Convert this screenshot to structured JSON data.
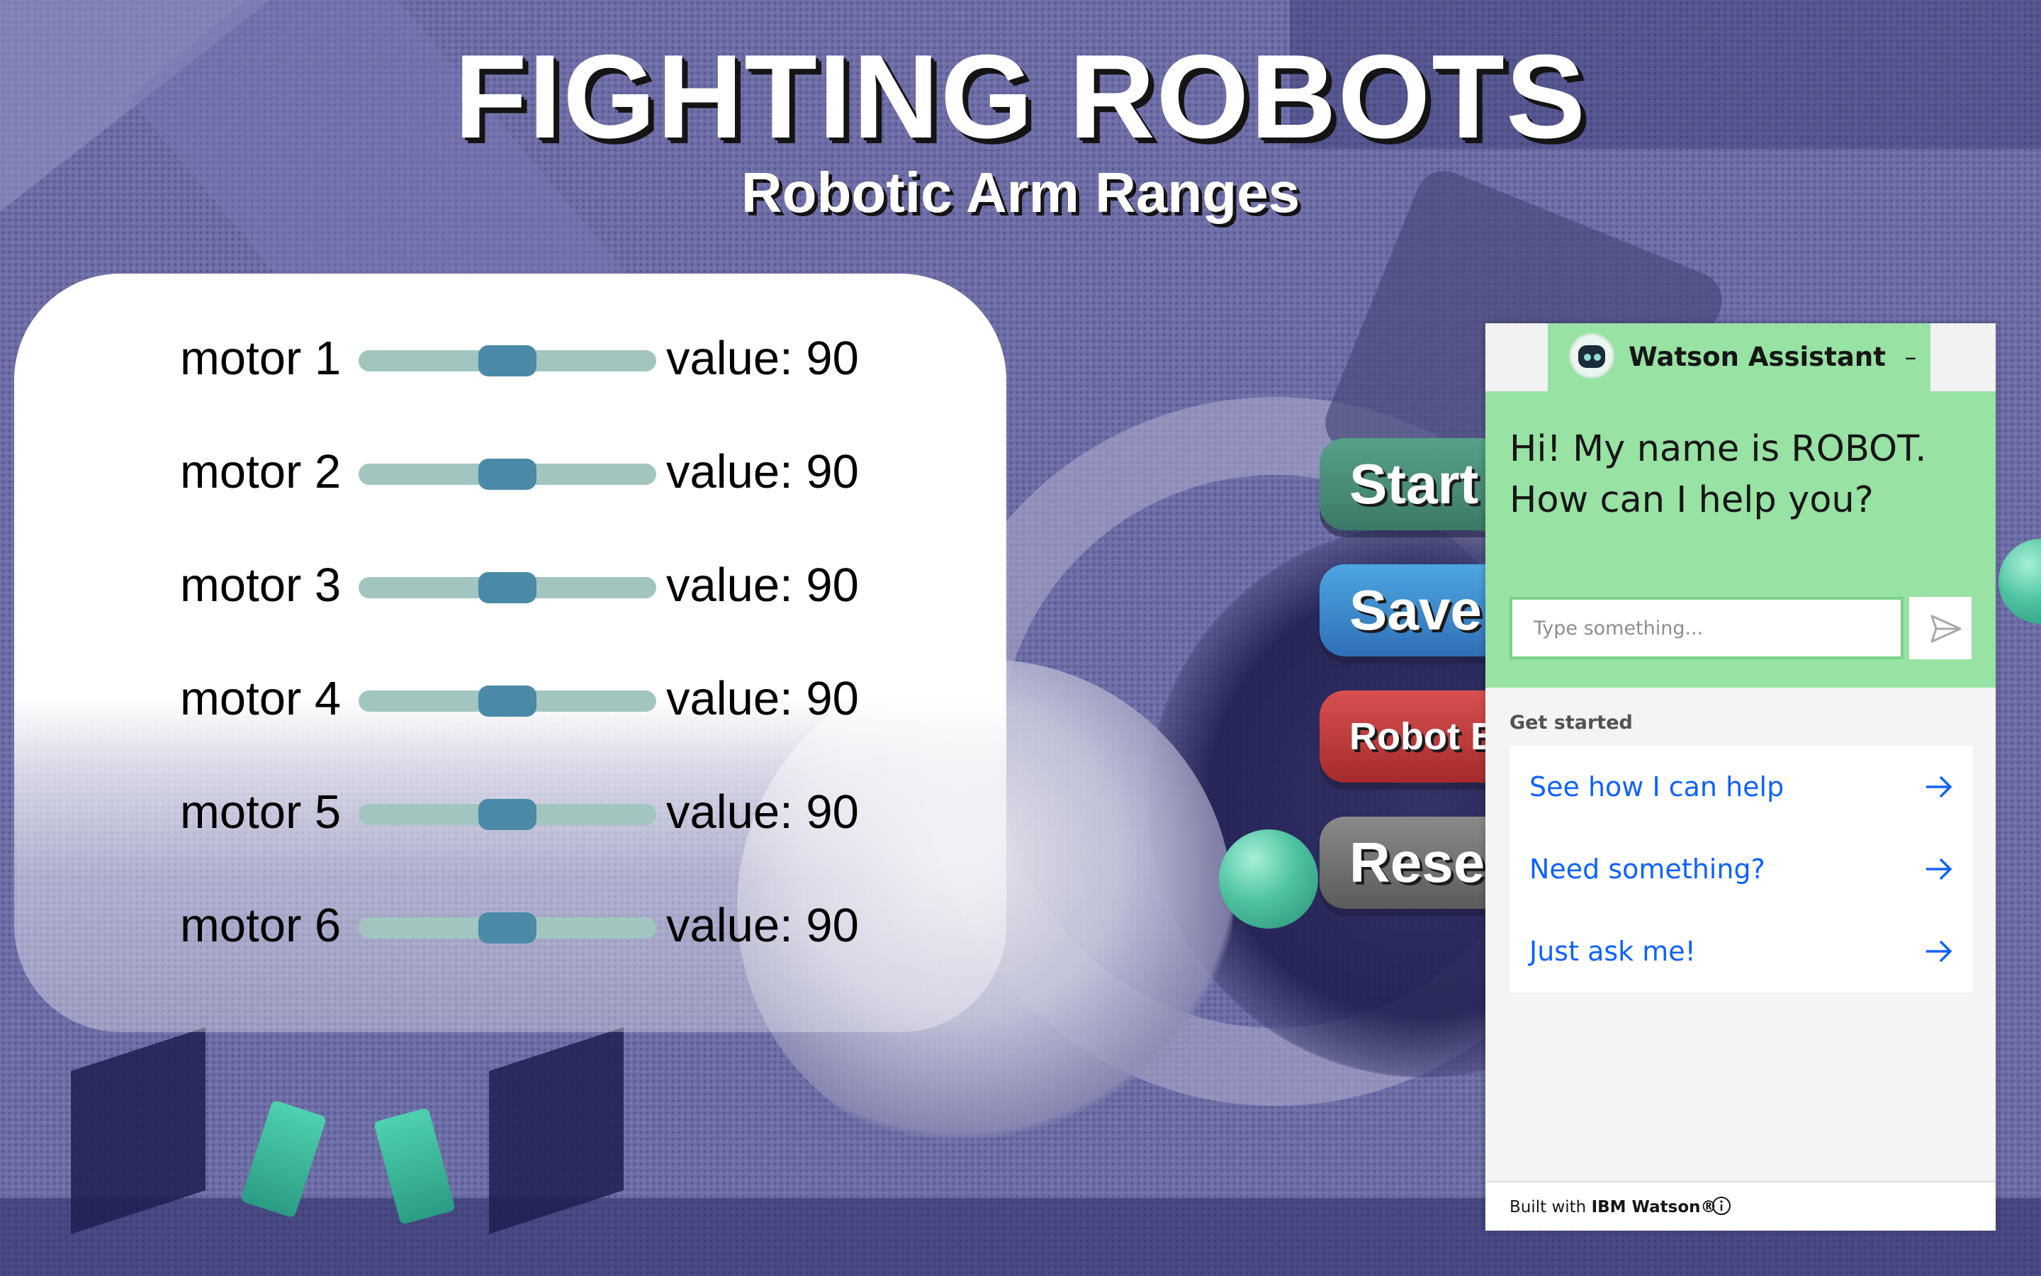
{
  "header": {
    "title": "FIGHTING ROBOTS",
    "subtitle": "Robotic Arm Ranges"
  },
  "motors": [
    {
      "label": "motor 1",
      "value_text": "value: 90",
      "value": 90,
      "min": 0,
      "max": 180
    },
    {
      "label": "motor 2",
      "value_text": "value: 90",
      "value": 90,
      "min": 0,
      "max": 180
    },
    {
      "label": "motor 3",
      "value_text": "value: 90",
      "value": 90,
      "min": 0,
      "max": 180
    },
    {
      "label": "motor 4",
      "value_text": "value: 90",
      "value": 90,
      "min": 0,
      "max": 180
    },
    {
      "label": "motor 5",
      "value_text": "value: 90",
      "value": 90,
      "min": 0,
      "max": 180
    },
    {
      "label": "motor 6",
      "value_text": "value: 90",
      "value": 90,
      "min": 0,
      "max": 180
    }
  ],
  "actions": {
    "start_label": "Start",
    "save_label": "Save",
    "robot_label": "Robot B",
    "reset_label": "Rese"
  },
  "watson": {
    "title": "Watson Assistant",
    "minimize_label": "–",
    "greeting": "Hi! My name is ROBOT. How can I help you?",
    "input_placeholder": "Type something...",
    "get_started_label": "Get started",
    "options": [
      {
        "label": "See how I can help"
      },
      {
        "label": "Need something?"
      },
      {
        "label": "Just ask me!"
      }
    ],
    "footer_prefix": "Built with ",
    "footer_brand": "IBM Watson®"
  },
  "colors": {
    "slider_track": "#a2c5c0",
    "slider_thumb": "#4a8aa6",
    "watson_accent": "#98e2a4",
    "watson_link": "#0f62fe",
    "start_button": "#4a8e78",
    "save_button": "#3f8bcf",
    "robot_button": "#c03c3c",
    "reset_button": "#737373"
  },
  "icons": {
    "send": "send-icon",
    "arrow": "arrow-right-icon",
    "info": "info-icon",
    "avatar": "robot-avatar-icon"
  }
}
